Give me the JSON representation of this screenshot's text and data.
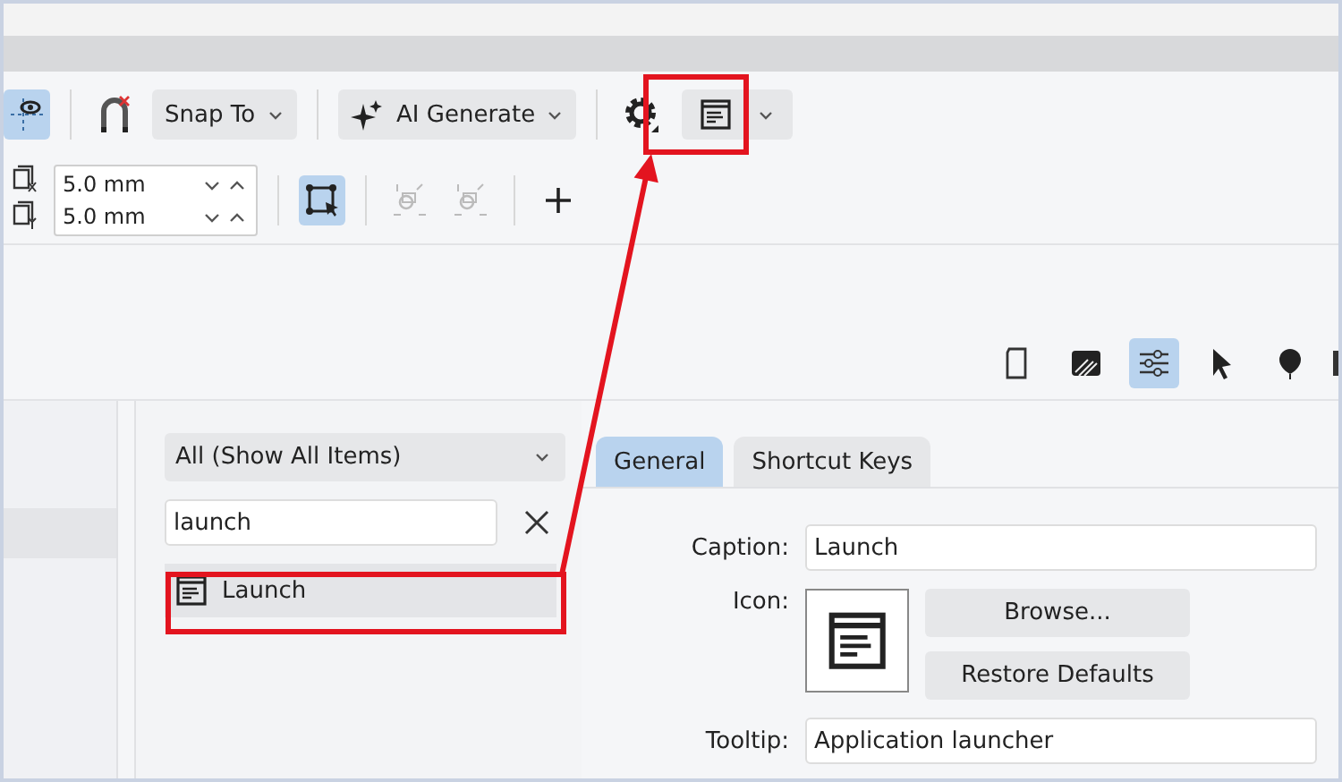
{
  "toolbar": {
    "guides_button": {
      "selected": true
    },
    "snap_dropdown": {
      "label": "Snap To"
    },
    "ai_dropdown": {
      "label": "AI Generate"
    }
  },
  "offsets": [
    {
      "value": "5.0 mm"
    },
    {
      "value": "5.0 mm"
    }
  ],
  "tools": [
    {
      "kind": "select",
      "selected": true,
      "disabled": false
    },
    {
      "kind": "link",
      "selected": false,
      "disabled": true
    },
    {
      "kind": "unlink",
      "selected": false,
      "disabled": true
    },
    {
      "kind": "add",
      "selected": false,
      "disabled": false
    }
  ],
  "panel_icons": [
    {
      "kind": "page",
      "selected": false
    },
    {
      "kind": "fill",
      "selected": false
    },
    {
      "kind": "sliders",
      "selected": true
    },
    {
      "kind": "pointer",
      "selected": false
    },
    {
      "kind": "pin",
      "selected": false
    }
  ],
  "sidebar": {
    "items": [
      {
        "selected": true
      }
    ]
  },
  "filter": {
    "value": "All (Show All Items)"
  },
  "search": {
    "value": "launch"
  },
  "results": [
    {
      "label": "Launch",
      "selected": true
    }
  ],
  "tabs": [
    {
      "label": "General",
      "selected": true
    },
    {
      "label": "Shortcut Keys",
      "selected": false
    }
  ],
  "form": {
    "caption_label": "Caption:",
    "caption_value": "Launch",
    "icon_label": "Icon:",
    "buttons": [
      "Browse...",
      "Restore Defaults"
    ],
    "tooltip_label": "Tooltip:",
    "tooltip_value": "Application launcher"
  }
}
